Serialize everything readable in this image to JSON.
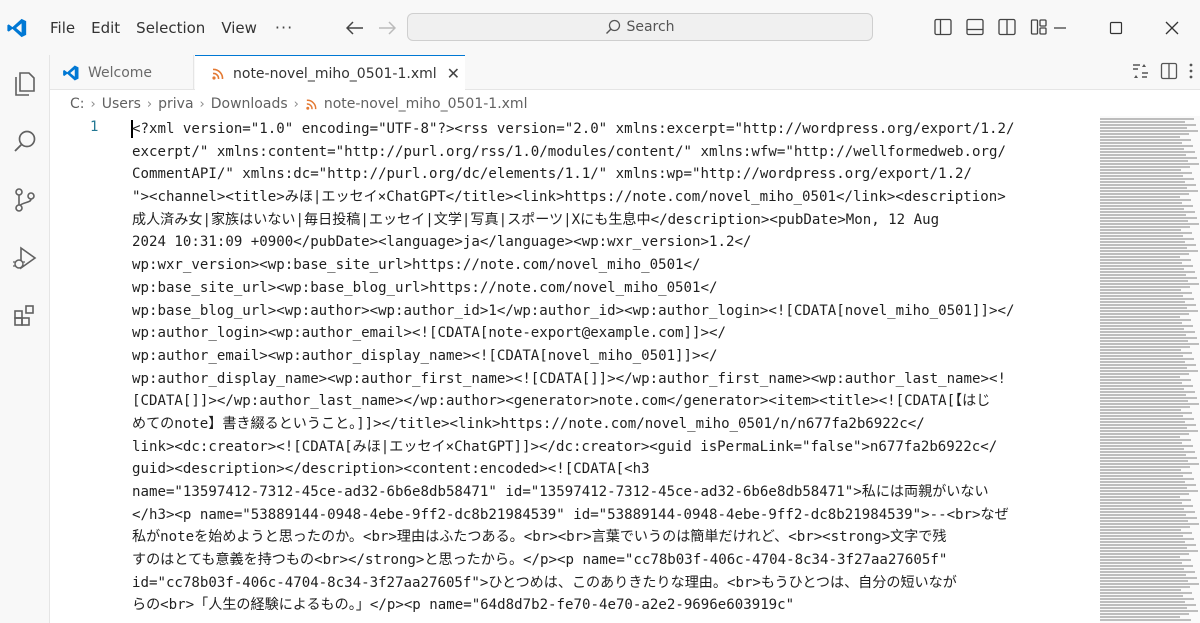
{
  "menu": {
    "items": [
      "File",
      "Edit",
      "Selection",
      "View"
    ],
    "more": "···"
  },
  "search": {
    "label": "Search"
  },
  "tabs": [
    {
      "label": "Welcome",
      "icon": "vscode-logo-icon"
    },
    {
      "label": "note-novel_miho_0501-1.xml",
      "icon": "rss-icon",
      "close": "✕",
      "active": true
    }
  ],
  "breadcrumb": {
    "parts": [
      "C:",
      "Users",
      "priva",
      "Downloads"
    ],
    "file": "note-novel_miho_0501-1.xml",
    "separator": "›"
  },
  "editor": {
    "line_number": "1",
    "lines": [
      "<?xml version=\"1.0\" encoding=\"UTF-8\"?><rss version=\"2.0\" xmlns:excerpt=\"http://wordpress.org/export/1.2/",
      "excerpt/\" xmlns:content=\"http://purl.org/rss/1.0/modules/content/\" xmlns:wfw=\"http://wellformedweb.org/",
      "CommentAPI/\" xmlns:dc=\"http://purl.org/dc/elements/1.1/\" xmlns:wp=\"http://wordpress.org/export/1.2/",
      "\"><channel><title>みほ|エッセイ×ChatGPT</title><link>https://note.com/novel_miho_0501</link><description>",
      "成人済み女|家族はいない|毎日投稿|エッセイ|文学|写真|スポーツ|Xにも生息中</description><pubDate>Mon, 12 Aug",
      "2024 10:31:09 +0900</pubDate><language>ja</language><wp:wxr_version>1.2</",
      "wp:wxr_version><wp:base_site_url>https://note.com/novel_miho_0501</",
      "wp:base_site_url><wp:base_blog_url>https://note.com/novel_miho_0501</",
      "wp:base_blog_url><wp:author><wp:author_id>1</wp:author_id><wp:author_login><![CDATA[novel_miho_0501]]></",
      "wp:author_login><wp:author_email><![CDATA[note-export@example.com]]></",
      "wp:author_email><wp:author_display_name><![CDATA[novel_miho_0501]]></",
      "wp:author_display_name><wp:author_first_name><![CDATA[]]></wp:author_first_name><wp:author_last_name><!",
      "[CDATA[]]></wp:author_last_name></wp:author><generator>note.com</generator><item><title><![CDATA[【はじ",
      "めてのnote】書き綴るということ。]]></title><link>https://note.com/novel_miho_0501/n/n677fa2b6922c</",
      "link><dc:creator><![CDATA[みほ|エッセイ×ChatGPT]]></dc:creator><guid isPermaLink=\"false\">n677fa2b6922c</",
      "guid><description></description><content:encoded><![CDATA[<h3",
      "name=\"13597412-7312-45ce-ad32-6b6e8db58471\" id=\"13597412-7312-45ce-ad32-6b6e8db58471\">私には両親がいない",
      "</h3><p name=\"53889144-0948-4ebe-9ff2-dc8b21984539\" id=\"53889144-0948-4ebe-9ff2-dc8b21984539\">--<br>なぜ",
      "私がnoteを始めようと思ったのか。<br>理由はふたつある。<br><br>言葉でいうのは簡単だけれど、<br><strong>文字で残",
      "すのはとても意義を持つもの<br></strong>と思ったから。</p><p name=\"cc78b03f-406c-4704-8c34-3f27aa27605f\"",
      "id=\"cc78b03f-406c-4704-8c34-3f27aa27605f\">ひとつめは、このありきたりな理由。<br>もうひとつは、自分の短いなが",
      "らの<br>「人生の経験によるもの。」</p><p name=\"64d8d7b2-fe70-4e70-a2e2-9696e603919c\""
    ]
  }
}
